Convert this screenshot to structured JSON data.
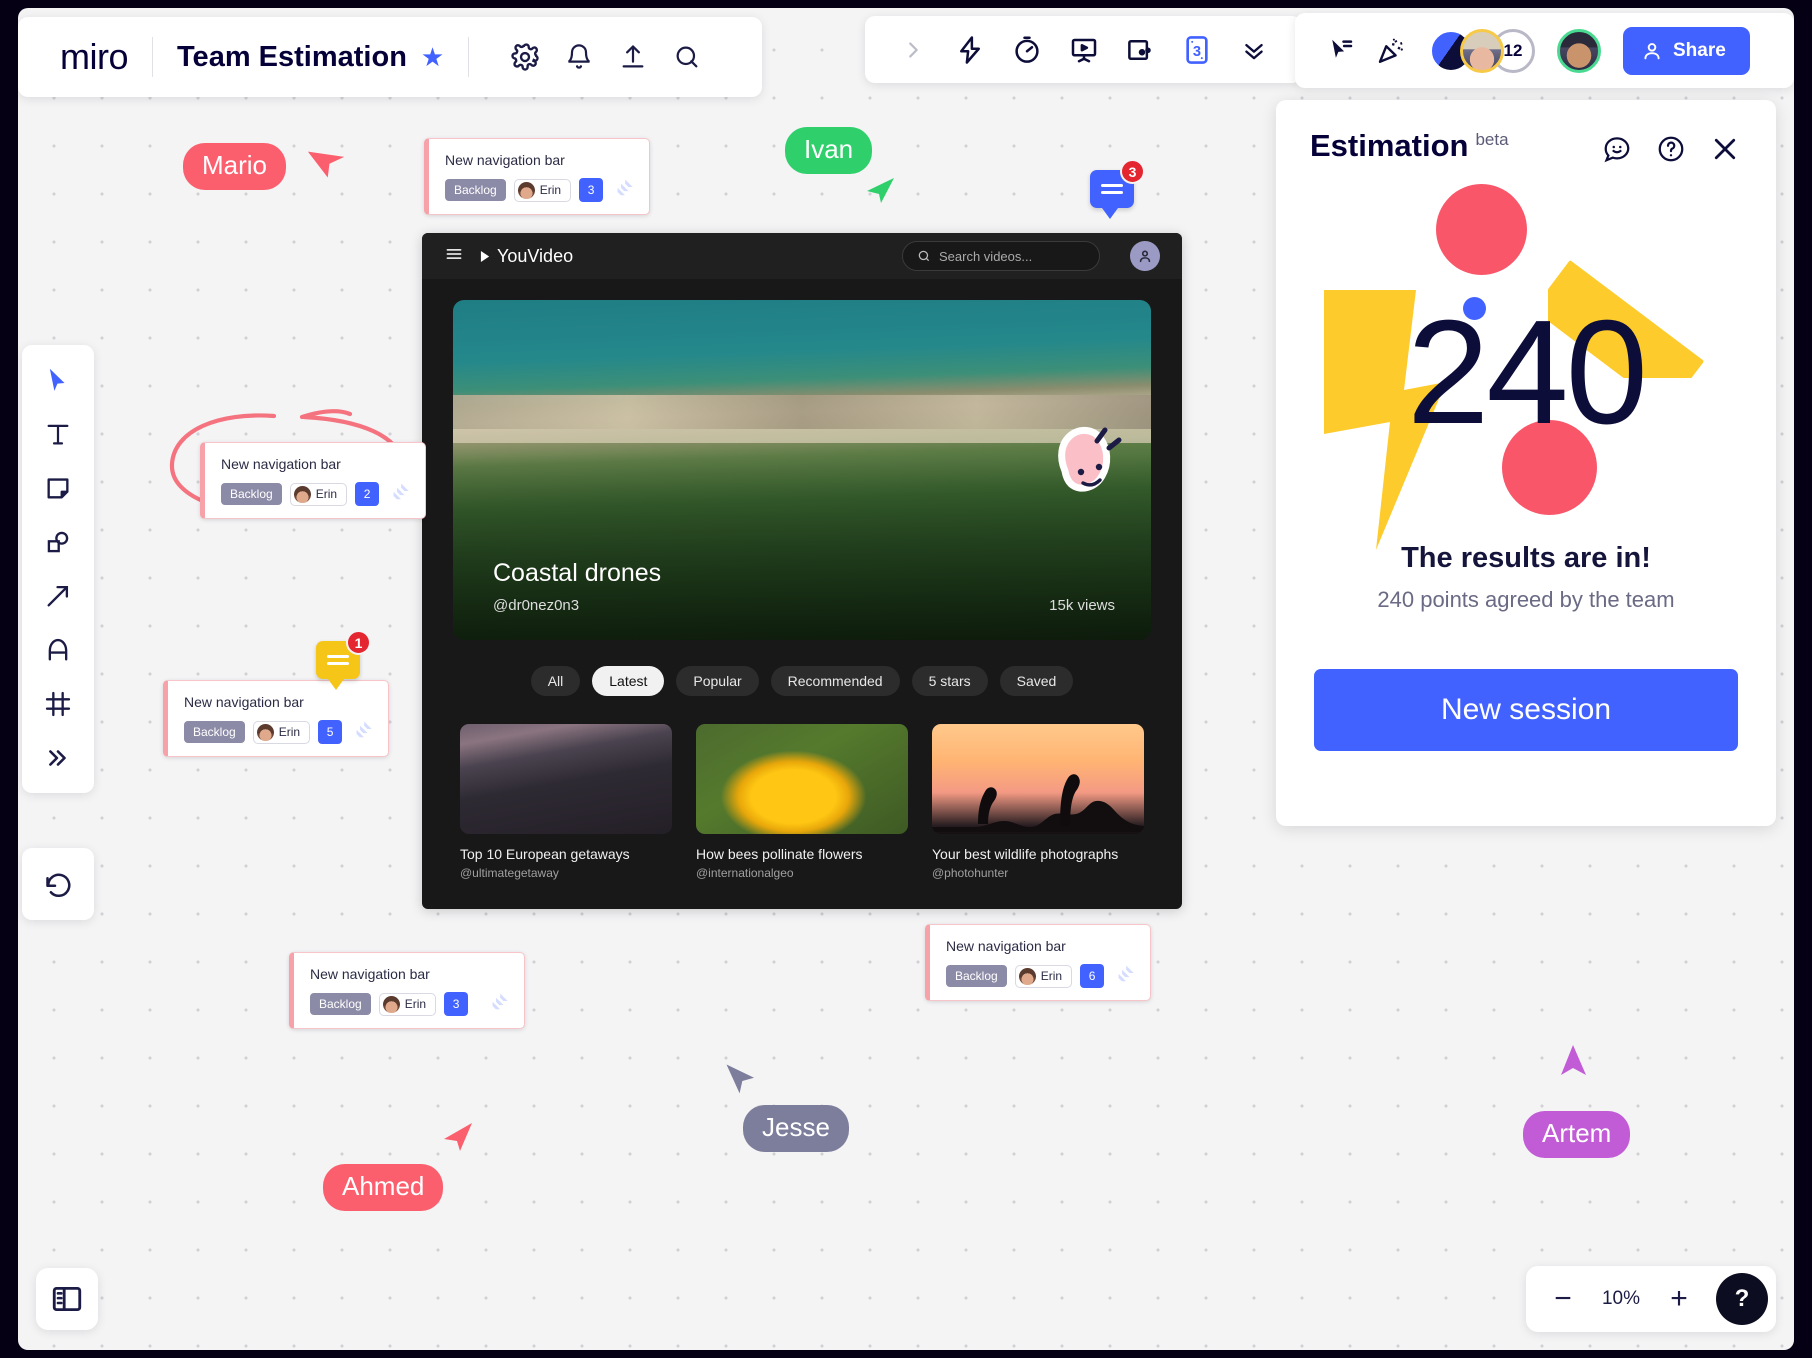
{
  "app": {
    "logo": "miro",
    "board_title": "Team Estimation",
    "favorite_icon": "star-icon",
    "settings_icon": "gear-icon",
    "notifications_icon": "bell-icon",
    "upload_icon": "upload-icon",
    "search_icon": "search-icon"
  },
  "center_toolbar": {
    "items": [
      {
        "name": "expand-chevron-icon",
        "label": ""
      },
      {
        "name": "lightning-bolt-icon",
        "label": ""
      },
      {
        "name": "timer-icon",
        "label": ""
      },
      {
        "name": "presentation-icon",
        "label": ""
      },
      {
        "name": "video-chat-icon",
        "label": ""
      },
      {
        "name": "estimation-card-icon",
        "label": "3"
      },
      {
        "name": "double-chevron-down-icon",
        "label": ""
      }
    ]
  },
  "right_toolbar": {
    "cursor_chat_icon": "cursor-chat-icon",
    "celebrate_icon": "party-popper-icon",
    "collaborator_count": "12",
    "share_label": "Share",
    "share_icon": "person-icon",
    "share_color": "#4262ff"
  },
  "left_tools": [
    {
      "name": "select-tool",
      "icon": "cursor-icon",
      "active": true
    },
    {
      "name": "text-tool",
      "icon": "text-T-icon",
      "active": false
    },
    {
      "name": "sticky-note-tool",
      "icon": "sticky-note-icon",
      "active": false
    },
    {
      "name": "shapes-tool",
      "icon": "shapes-icon",
      "active": false
    },
    {
      "name": "connector-tool",
      "icon": "arrow-icon",
      "active": false
    },
    {
      "name": "pen-tool",
      "icon": "pen-icon",
      "active": false
    },
    {
      "name": "frame-tool",
      "icon": "frame-icon",
      "active": false
    },
    {
      "name": "more-tools",
      "icon": "double-chevron-right-icon",
      "active": false
    }
  ],
  "undo_icon": "undo-icon",
  "bottom": {
    "panel_toggle_icon": "sidebar-panel-icon",
    "zoom_out_icon": "minus-icon",
    "zoom_level": "10%",
    "zoom_in_icon": "plus-icon",
    "help_label": "?"
  },
  "estimation_panel": {
    "title": "Estimation",
    "beta_label": "beta",
    "feedback_icon": "smiley-chat-icon",
    "help_icon": "question-circle-icon",
    "close_icon": "close-icon",
    "result_number": "240",
    "headline": "The results are in!",
    "subtext": "240 points agreed by the team",
    "button_label": "New session",
    "accent_blue": "#4262ff",
    "accent_red": "#f9566a",
    "accent_yellow": "#fdcb2c",
    "number_color": "#0d0d3a"
  },
  "youvideo": {
    "menu_icon": "hamburger-menu-icon",
    "brand": "YouVideo",
    "brand_icon": "play-triangle-icon",
    "search_placeholder": "Search videos...",
    "search_icon": "search-icon",
    "account_icon": "person-icon",
    "hero": {
      "title": "Coastal drones",
      "author": "@dr0nez0n3",
      "views": "15k views"
    },
    "filters": [
      {
        "label": "All",
        "selected": false
      },
      {
        "label": "Latest",
        "selected": true
      },
      {
        "label": "Popular",
        "selected": false
      },
      {
        "label": "Recommended",
        "selected": false
      },
      {
        "label": "5 stars",
        "selected": false
      },
      {
        "label": "Saved",
        "selected": false
      }
    ],
    "videos": [
      {
        "title": "Top 10 European getaways",
        "author": "@ultimategetaway"
      },
      {
        "title": "How bees pollinate flowers",
        "author": "@internationalgeo"
      },
      {
        "title": "Your best wildlife photographs",
        "author": "@photohunter"
      }
    ]
  },
  "cards": [
    {
      "title": "New navigation bar",
      "status": "Backlog",
      "assignee": "Erin",
      "points": "3"
    },
    {
      "title": "New navigation bar",
      "status": "Backlog",
      "assignee": "Erin",
      "points": "2"
    },
    {
      "title": "New navigation bar",
      "status": "Backlog",
      "assignee": "Erin",
      "points": "5"
    },
    {
      "title": "New navigation bar",
      "status": "Backlog",
      "assignee": "Erin",
      "points": "3"
    },
    {
      "title": "New navigation bar",
      "status": "Backlog",
      "assignee": "Erin",
      "points": "6"
    }
  ],
  "cursors": [
    {
      "name": "Mario",
      "color": "#fb5f6e"
    },
    {
      "name": "Ivan",
      "color": "#2fd06c"
    },
    {
      "name": "Jesse",
      "color": "#7d7d9c"
    },
    {
      "name": "Ahmed",
      "color": "#fb5f6e"
    },
    {
      "name": "Artem",
      "color": "#c15bd6"
    }
  ],
  "comment_pins": [
    {
      "count": "3",
      "color": "#4262ff"
    },
    {
      "count": "1",
      "color": "#f5c518"
    }
  ]
}
